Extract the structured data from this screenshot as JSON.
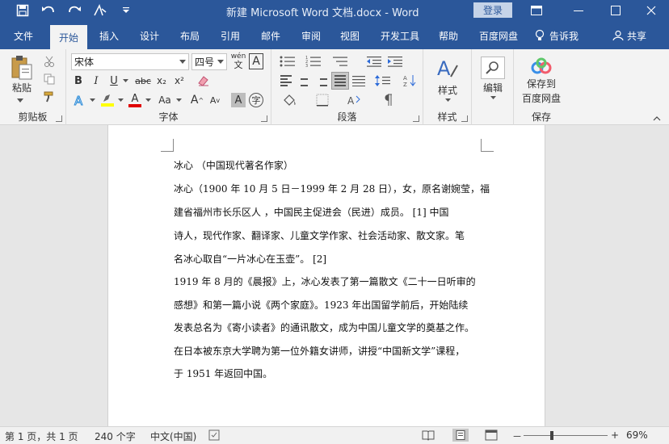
{
  "titlebar": {
    "title": "新建 Microsoft Word 文档.docx  -  Word",
    "login": "登录"
  },
  "tabs": [
    "文件",
    "开始",
    "插入",
    "设计",
    "布局",
    "引用",
    "邮件",
    "审阅",
    "视图",
    "开发工具",
    "帮助",
    "百度网盘"
  ],
  "active_tab": "开始",
  "tellme": "告诉我",
  "share": "共享",
  "ribbon": {
    "clipboard": {
      "paste": "粘贴",
      "label": "剪贴板"
    },
    "font": {
      "name": "宋体",
      "size": "四号",
      "label": "字体",
      "bold": "B",
      "italic": "I",
      "underline": "U",
      "strike": "abc",
      "sub": "x₂",
      "sup": "x²",
      "case": "Aa",
      "grow": "A",
      "shrink": "A",
      "wen": "wén",
      "phonetic_char": "文",
      "enclose": "字"
    },
    "paragraph": {
      "label": "段落"
    },
    "styles": {
      "button": "样式",
      "label": "样式"
    },
    "editing": {
      "button": "编辑"
    },
    "save": {
      "line1": "保存到",
      "line2": "百度网盘",
      "label": "保存"
    }
  },
  "document": {
    "lines": [
      "冰心 （中国现代著名作家）",
      "冰心（1900 年 10 月 5 日－1999 年 2 月 28 日），女，原名谢婉莹，福",
      "建省福州市长乐区人 ，中国民主促进会（民进）成员。 [1]   中国",
      "诗人，现代作家、翻译家、儿童文学作家、社会活动家、散文家。笔",
      "名冰心取自“一片冰心在玉壶”。 [2]",
      "1919 年 8 月的《晨报》上，冰心发表了第一篇散文《二十一日听审的",
      "感想》和第一篇小说《两个家庭》。1923 年出国留学前后，开始陆续",
      "发表总名为《寄小读者》的通讯散文，成为中国儿童文学的奠基之作。",
      "在日本被东京大学聘为第一位外籍女讲师，讲授“中国新文学”课程，",
      "于 1951 年返回中国。"
    ]
  },
  "status": {
    "page": "第 1 页，共 1 页",
    "words": "240 个字",
    "language": "中文(中国)",
    "zoom": "69%",
    "zoom_minus": "－",
    "zoom_plus": "+"
  },
  "colors": {
    "accent": "#2b579a",
    "highlight": "#ffff00",
    "font_color": "#e00000"
  }
}
